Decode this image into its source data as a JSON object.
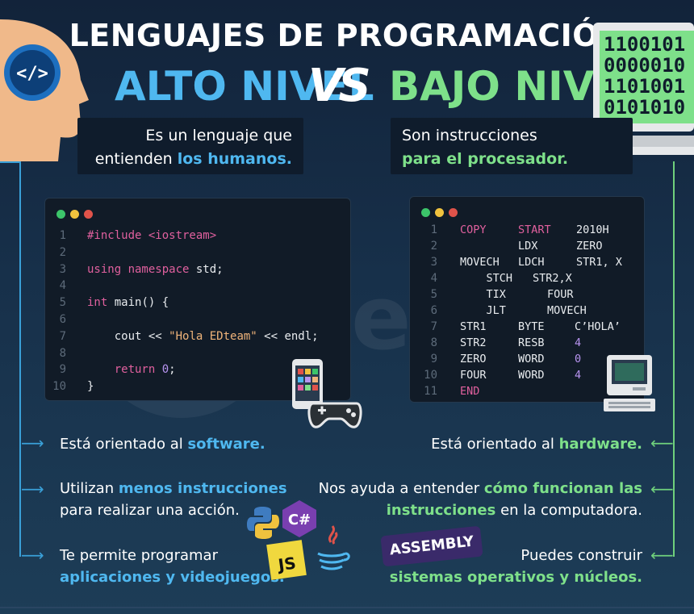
{
  "header": {
    "title": "LENGUAJES DE PROGRAMACIÓN",
    "left_label": "ALTO NIVEL",
    "vs": "VS",
    "right_label": "BAJO NIVEL"
  },
  "left": {
    "desc_prefix": "Es un lenguaje que",
    "desc_line2_prefix": "entienden ",
    "desc_highlight": "los humanos.",
    "code": {
      "line_numbers": [
        "1",
        "2",
        "3",
        "4",
        "5",
        "6",
        "7",
        "8",
        "9",
        "10"
      ],
      "lines": [
        {
          "a": "#include <iostream>",
          "b": "",
          "c": ""
        },
        {
          "a": "",
          "b": "",
          "c": ""
        },
        {
          "a": "using namespace",
          "b": " std;",
          "c": ""
        },
        {
          "a": "",
          "b": "",
          "c": ""
        },
        {
          "a": "int",
          "b": " main() {",
          "c": ""
        },
        {
          "a": "",
          "b": "",
          "c": ""
        },
        {
          "a": "    cout << ",
          "b": "\"Hola EDteam\"",
          "c": " << endl;"
        },
        {
          "a": "",
          "b": "",
          "c": ""
        },
        {
          "a": "    return",
          "b": " 0",
          "c": ";"
        },
        {
          "a": "}",
          "b": "",
          "c": ""
        }
      ]
    },
    "bullets": [
      {
        "text": "Está orientado al ",
        "highlight": "software.",
        "line2": ""
      },
      {
        "text": "Utilizan ",
        "highlight": "menos instrucciones",
        "line2": "para realizar una acción."
      },
      {
        "text": "Te permite programar",
        "highlight": "",
        "line2": "aplicaciones y videojuegos."
      }
    ]
  },
  "right": {
    "desc_line1": "Son instrucciones",
    "desc_highlight": "para el procesador.",
    "binary": [
      "1100101",
      "0000010",
      "1101001",
      "0101010"
    ],
    "code": {
      "line_numbers": [
        "1",
        "2",
        "3",
        "4",
        "5",
        "6",
        "7",
        "8",
        "9",
        "10",
        "11"
      ],
      "lines": [
        {
          "c1": "COPY",
          "c2": "START",
          "c3": "2010H"
        },
        {
          "c1": "",
          "c2": "LDX",
          "c3": "ZERO"
        },
        {
          "c1": "MOVECH",
          "c2": "LDCH",
          "c3": "STR1, X"
        },
        {
          "c1": "    STCH",
          "c2": "STR2,X",
          "c3": ""
        },
        {
          "c1": "    TIX",
          "c2": "FOUR",
          "c3": ""
        },
        {
          "c1": "    JLT",
          "c2": "MOVECH",
          "c3": ""
        },
        {
          "c1": "STR1",
          "c2": "BYTE",
          "c3": "C’HOLA’"
        },
        {
          "c1": "STR2",
          "c2": "RESB",
          "c3": "4"
        },
        {
          "c1": "ZERO",
          "c2": "WORD",
          "c3": "0"
        },
        {
          "c1": "FOUR",
          "c2": "WORD",
          "c3": "4"
        },
        {
          "c1": "END",
          "c2": "",
          "c3": ""
        }
      ]
    },
    "bullets": [
      {
        "text": "Está orientado al ",
        "highlight": "hardware."
      },
      {
        "text": "Nos ayuda a entender ",
        "highlight": "cómo funcionan las",
        "line2_highlight": "instrucciones",
        "line2": " en la computadora."
      },
      {
        "text": "Puedes construir",
        "line2_highlight": "sistemas operativos y núcleos."
      }
    ],
    "badge": "ASSEMBLY"
  },
  "watermark": "EDteam",
  "icons": {
    "js_label": "JS",
    "csharp_label": "C#"
  },
  "colors": {
    "blue": "#4fb8f0",
    "green": "#7ee08a",
    "background": "#17304a"
  }
}
